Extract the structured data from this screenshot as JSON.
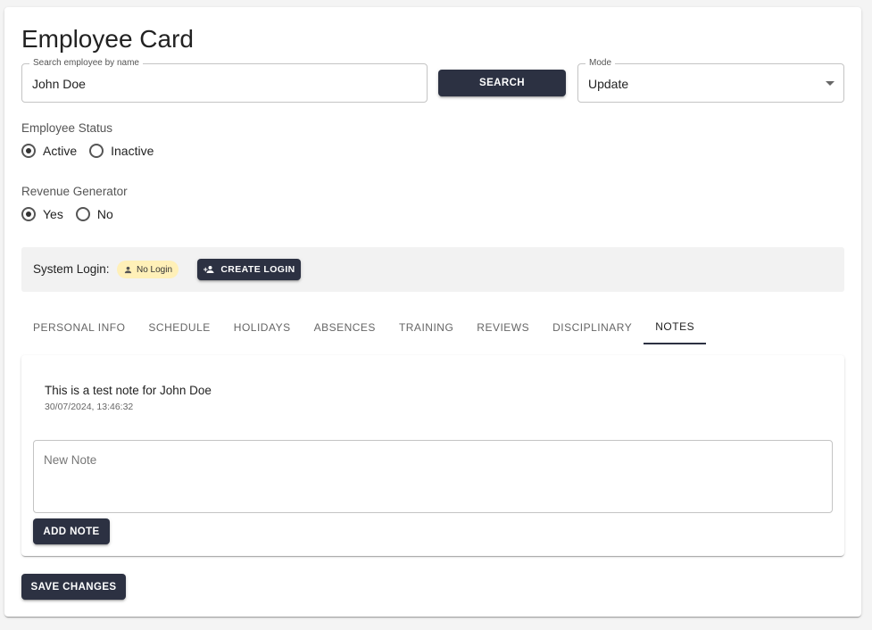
{
  "page": {
    "title": "Employee Card"
  },
  "search": {
    "legend": "Search employee by name",
    "value": "John Doe",
    "button_label": "SEARCH"
  },
  "mode": {
    "legend": "Mode",
    "value": "Update"
  },
  "employee_status": {
    "label": "Employee Status",
    "options": [
      {
        "label": "Active",
        "checked": true
      },
      {
        "label": "Inactive",
        "checked": false
      }
    ]
  },
  "revenue_generator": {
    "label": "Revenue Generator",
    "options": [
      {
        "label": "Yes",
        "checked": true
      },
      {
        "label": "No",
        "checked": false
      }
    ]
  },
  "system_login": {
    "label": "System Login:",
    "status_chip": "No Login",
    "create_button": "CREATE LOGIN"
  },
  "tabs": [
    {
      "label": "PERSONAL INFO",
      "active": false
    },
    {
      "label": "SCHEDULE",
      "active": false
    },
    {
      "label": "HOLIDAYS",
      "active": false
    },
    {
      "label": "ABSENCES",
      "active": false
    },
    {
      "label": "TRAINING",
      "active": false
    },
    {
      "label": "REVIEWS",
      "active": false
    },
    {
      "label": "DISCIPLINARY",
      "active": false
    },
    {
      "label": "NOTES",
      "active": true
    }
  ],
  "notes": {
    "items": [
      {
        "text": "This is a test note for John Doe",
        "timestamp": "30/07/2024, 13:46:32"
      }
    ],
    "new_note_placeholder": "New Note",
    "add_button": "ADD NOTE"
  },
  "footer": {
    "save_button": "SAVE CHANGES"
  },
  "colors": {
    "primary_button": "#2c3142",
    "chip_background": "#fff0b8",
    "login_bar_background": "#f2f2f2"
  }
}
